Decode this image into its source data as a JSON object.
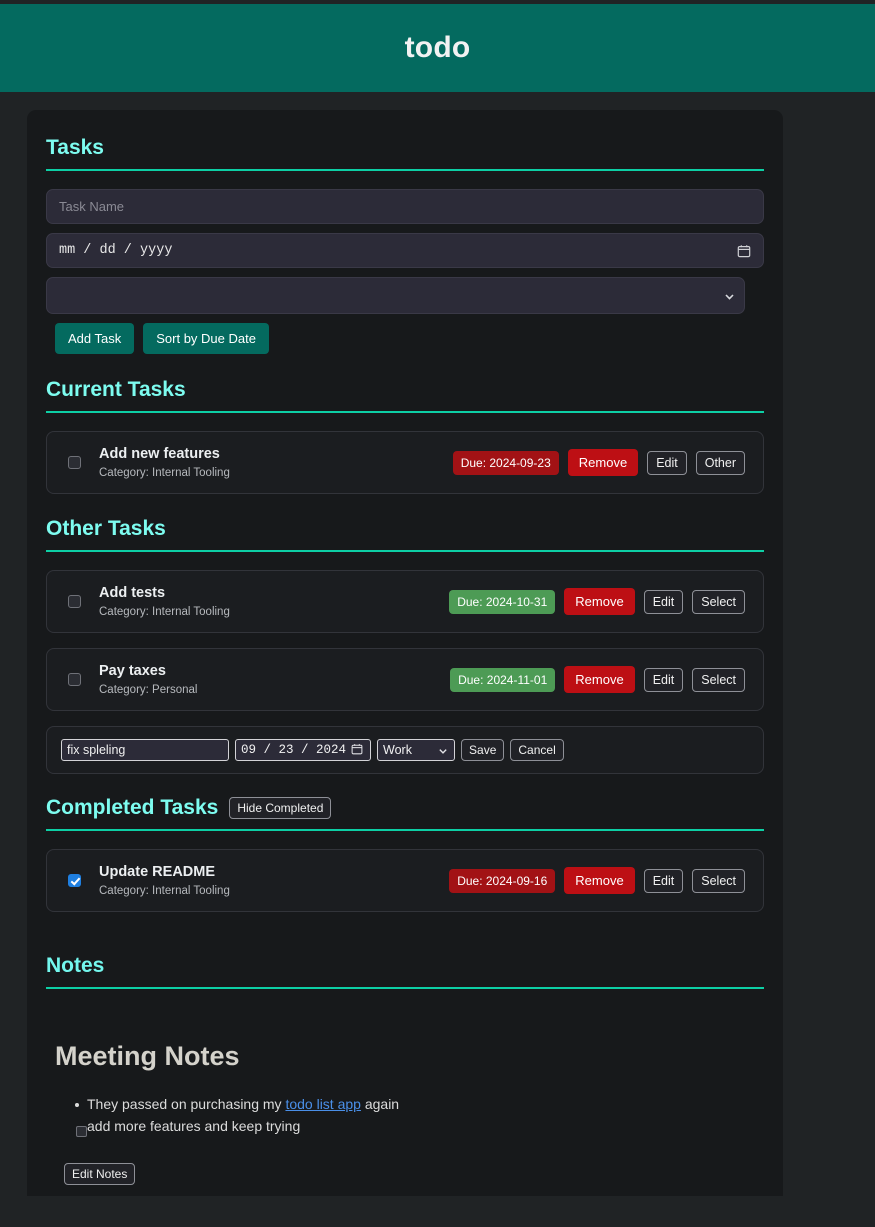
{
  "header": {
    "title": "todo"
  },
  "tasks_section": {
    "heading": "Tasks",
    "new_task": {
      "name_placeholder": "Task Name",
      "name_value": "",
      "date_placeholder": "mm / dd / yyyy",
      "category_value": "",
      "calendar_icon": "calendar-icon",
      "chevron_icon": "chevron-down-icon"
    },
    "add_button": "Add Task",
    "sort_button": "Sort by Due Date"
  },
  "current_tasks": {
    "heading": "Current Tasks",
    "items": [
      {
        "title": "Add new features",
        "category": "Category: Internal Tooling",
        "due": "Due: 2024-09-23",
        "due_color": "#a21215",
        "due_state": "red",
        "checked": false,
        "remove": "Remove",
        "edit": "Edit",
        "third": "Other"
      }
    ]
  },
  "other_tasks": {
    "heading": "Other Tasks",
    "items": [
      {
        "title": "Add tests",
        "category": "Category: Internal Tooling",
        "due": "Due: 2024-10-31",
        "due_color": "#4d9b55",
        "due_state": "green",
        "checked": false,
        "remove": "Remove",
        "edit": "Edit",
        "third": "Select"
      },
      {
        "title": "Pay taxes",
        "category": "Category: Personal",
        "due": "Due: 2024-11-01",
        "due_color": "#4d9b55",
        "due_state": "green",
        "checked": false,
        "remove": "Remove",
        "edit": "Edit",
        "third": "Select"
      }
    ],
    "edit_row": {
      "name_value": "fix spleling",
      "date_value": "09 / 23 / 2024",
      "category_value": "Work",
      "save": "Save",
      "cancel": "Cancel",
      "calendar_icon": "calendar-icon",
      "chevron_icon": "chevron-down-icon"
    }
  },
  "completed_tasks": {
    "heading": "Completed Tasks",
    "hide_button": "Hide Completed",
    "items": [
      {
        "title": "Update README",
        "category": "Category: Internal Tooling",
        "due": "Due: 2024-09-16",
        "due_color": "#a21215",
        "due_state": "red",
        "checked": true,
        "remove": "Remove",
        "edit": "Edit",
        "third": "Select"
      }
    ]
  },
  "notes_section": {
    "heading": "Notes",
    "title": "Meeting Notes",
    "bullet_before_link": "They passed on purchasing my ",
    "bullet_link": "todo list app",
    "bullet_after_link": " again",
    "checklist_item": "add more features and keep trying",
    "checklist_checked": false,
    "edit_button": "Edit Notes"
  },
  "colors": {
    "accent_teal": "#046a5f",
    "heading_cyan": "#7dfcf0",
    "rule_teal": "#0dcfa5",
    "danger_red": "#bd0f14",
    "badge_red": "#a21215",
    "badge_green": "#4d9b55",
    "link_blue": "#4a8fe8",
    "checkbox_blue": "#1f7fe0",
    "page_bg": "#202325",
    "panel_bg": "#17191b",
    "card_bg": "#1b1d20"
  }
}
